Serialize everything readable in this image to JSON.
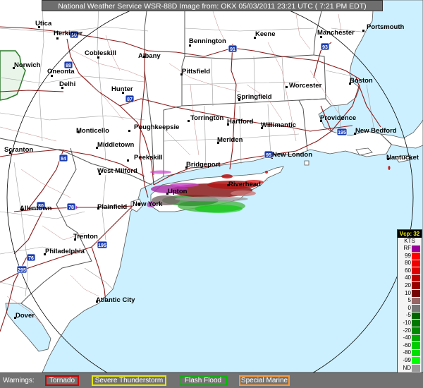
{
  "title": "National Weather Service WSR-88D Image from:  OKX  05/03/2011  23:21 UTC  ( 7:21 PM EDT)",
  "legend": {
    "title": "Vcp: 32",
    "units": "KTS",
    "entries": [
      {
        "label": "RF",
        "color": "#990099"
      },
      {
        "label": "99",
        "color": "#ff0000"
      },
      {
        "label": "80",
        "color": "#ee0000"
      },
      {
        "label": "60",
        "color": "#dd0000"
      },
      {
        "label": "40",
        "color": "#bb0000"
      },
      {
        "label": "20",
        "color": "#990000"
      },
      {
        "label": "10",
        "color": "#770000"
      },
      {
        "label": "5",
        "color": "#996666"
      },
      {
        "label": "0",
        "color": "#777777"
      },
      {
        "label": "-5",
        "color": "#006600"
      },
      {
        "label": "-10",
        "color": "#007700"
      },
      {
        "label": "-20",
        "color": "#008800"
      },
      {
        "label": "-40",
        "color": "#00aa00"
      },
      {
        "label": "-60",
        "color": "#00cc00"
      },
      {
        "label": "-80",
        "color": "#00e000"
      },
      {
        "label": "-99",
        "color": "#00ff00"
      },
      {
        "label": "ND",
        "color": "#999999"
      }
    ]
  },
  "warnings": {
    "label": "Warnings:",
    "items": [
      {
        "label": "Tornado",
        "color": "#cc0000"
      },
      {
        "label": "Severe Thunderstorm",
        "color": "#e8e800"
      },
      {
        "label": "Flash Flood",
        "color": "#00bb00"
      },
      {
        "label": "Special Marine",
        "color": "#ff9933"
      }
    ]
  },
  "cities": [
    "Utica",
    "Herkimer",
    "Norwich",
    "Oneonta",
    "Cobleskill",
    "Albany",
    "Delhi",
    "Hunter",
    "Bennington",
    "Keene",
    "Manchester",
    "Portsmouth",
    "Pittsfield",
    "Worcester",
    "Boston",
    "Springfield",
    "Torrington",
    "Hartford",
    "Willimantic",
    "Providence",
    "New Bedford",
    "Monticello",
    "Poughkeepsie",
    "Meriden",
    "Middletown",
    "Peekskill",
    "Bridgeport",
    "New London",
    "Nantucket",
    "Scranton",
    "West Milford",
    "Riverhead",
    "Upton",
    "Allentown",
    "Plainfield",
    "New York",
    "Trenton",
    "Philadelphia",
    "Atlantic City",
    "Dover"
  ],
  "shields": [
    "90",
    "88",
    "91",
    "93",
    "87",
    "84",
    "95",
    "80",
    "78",
    "195",
    "76",
    "295"
  ],
  "colors": {
    "ocean": "#ccf0ff",
    "land": "#ffffff",
    "range_ring": "#000000"
  }
}
